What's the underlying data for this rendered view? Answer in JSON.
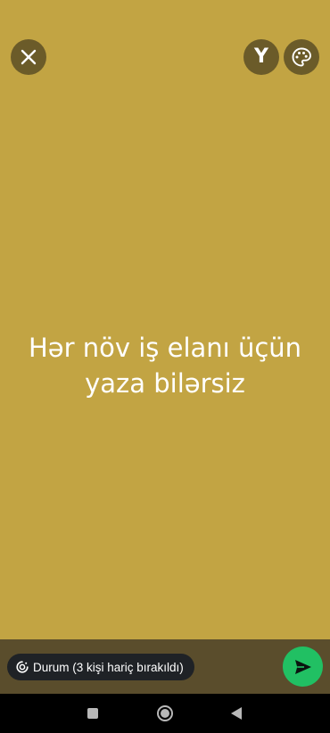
{
  "top_bar": {
    "close_icon": "close-icon",
    "font_button_label": "Y",
    "palette_icon": "palette-icon"
  },
  "status": {
    "text_line1": "Hər növ iş elanı üçün",
    "text_line2": "yaza bilərsiz",
    "background_color": "#c2a443",
    "text_color": "#ffffff"
  },
  "bottom_bar": {
    "audience_label": "Durum (3 kişi hariç bırakıldı)",
    "audience_icon": "status-ring-icon",
    "send_icon": "send-icon",
    "send_color": "#21c063"
  },
  "nav_bar": {
    "recent_icon": "recent-apps-icon",
    "home_icon": "home-icon",
    "back_icon": "back-icon"
  }
}
